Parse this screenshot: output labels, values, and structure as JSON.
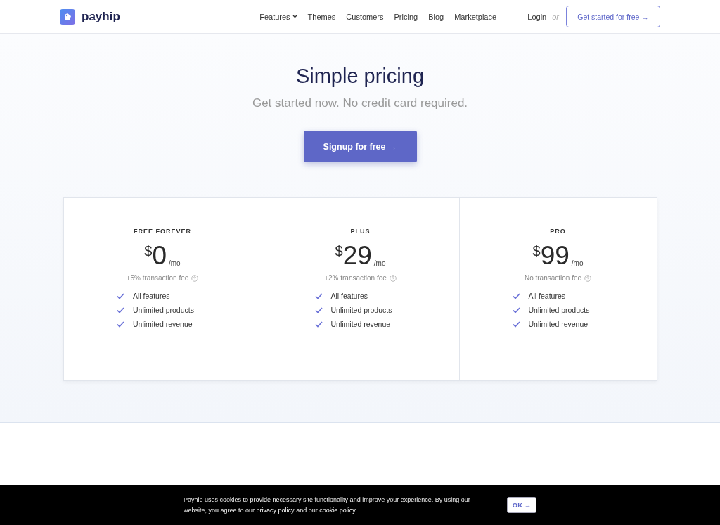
{
  "brand": {
    "name": "payhip"
  },
  "nav": [
    {
      "label": "Features",
      "has_menu": true
    },
    {
      "label": "Themes",
      "has_menu": false
    },
    {
      "label": "Customers",
      "has_menu": false
    },
    {
      "label": "Pricing",
      "has_menu": false
    },
    {
      "label": "Blog",
      "has_menu": false
    },
    {
      "label": "Marketplace",
      "has_menu": false
    }
  ],
  "login": "Login",
  "or": "or",
  "cta": "Get started for free →",
  "hero": {
    "title": "Simple pricing",
    "subtitle": "Get started now. No credit card required.",
    "button": "Signup for free →"
  },
  "plans": [
    {
      "name": "FREE FOREVER",
      "currency": "$",
      "price": "0",
      "period": "/mo",
      "fee": "+5% transaction fee",
      "features": [
        "All features",
        "Unlimited products",
        "Unlimited revenue"
      ]
    },
    {
      "name": "PLUS",
      "currency": "$",
      "price": "29",
      "period": "/mo",
      "fee": "+2% transaction fee",
      "features": [
        "All features",
        "Unlimited products",
        "Unlimited revenue"
      ]
    },
    {
      "name": "PRO",
      "currency": "$",
      "price": "99",
      "period": "/mo",
      "fee": "No transaction fee",
      "features": [
        "All features",
        "Unlimited products",
        "Unlimited revenue"
      ]
    }
  ],
  "cookie": {
    "text_before": "Payhip uses cookies to provide necessary site functionality and improve your experience. By using our website, you agree to our",
    "privacy_link": "privacy policy",
    "text_middle": "and our",
    "cookie_link": "cookie policy",
    "text_after": ".",
    "button": "OK →"
  }
}
